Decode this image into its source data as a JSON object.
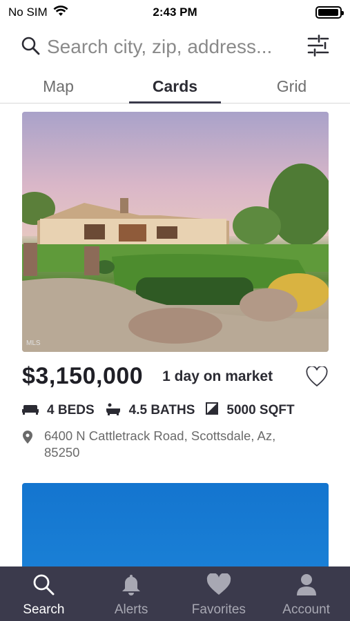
{
  "status_bar": {
    "carrier": "No SIM",
    "time": "2:43 PM",
    "battery_level": 0.95
  },
  "search": {
    "placeholder": "Search city, zip, address...",
    "search_icon": "search-icon",
    "filter_icon": "sliders-icon"
  },
  "tabs": [
    {
      "label": "Map",
      "active": false
    },
    {
      "label": "Cards",
      "active": true
    },
    {
      "label": "Grid",
      "active": false
    }
  ],
  "listing": {
    "price": "$3,150,000",
    "days_on_market": "1 day on market",
    "beds": "4 BEDS",
    "baths": "4.5 BATHS",
    "sqft": "5000 SQFT",
    "address": "6400 N Cattletrack Road, Scottsdale, Az, 85250",
    "image_watermark": "MLS"
  },
  "bottom_nav": [
    {
      "label": "Search",
      "icon": "search-icon",
      "active": true
    },
    {
      "label": "Alerts",
      "icon": "bell-icon",
      "active": false
    },
    {
      "label": "Favorites",
      "icon": "heart-icon",
      "active": false
    },
    {
      "label": "Account",
      "icon": "person-icon",
      "active": false
    }
  ],
  "colors": {
    "nav_background": "#3b3a4c",
    "active_tab_underline": "#3a3a4a",
    "second_card_sky": "#1475cf"
  }
}
